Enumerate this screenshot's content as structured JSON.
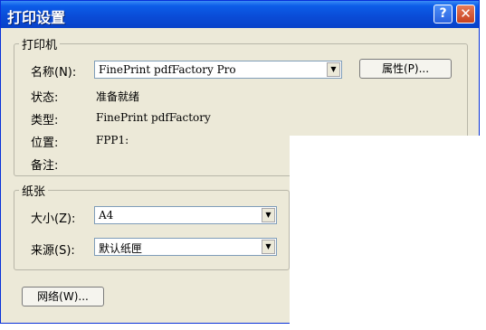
{
  "window": {
    "title": "打印设置",
    "help_icon": "?",
    "close_icon": "✕"
  },
  "printer_group": {
    "legend": "打印机",
    "name_label": "名称(N):",
    "name_value": "FinePrint pdfFactory Pro",
    "properties_button": "属性(P)...",
    "status_label": "状态:",
    "status_value": "准备就绪",
    "type_label": "类型:",
    "type_value": "FinePrint pdfFactory",
    "location_label": "位置:",
    "location_value": "FPP1:",
    "comment_label": "备注:"
  },
  "paper_group": {
    "legend": "纸张",
    "size_label": "大小(Z):",
    "size_value": "A4",
    "source_label": "来源(S):",
    "source_value": "默认纸匣"
  },
  "network_button": "网络(W)...",
  "dropdown_arrow": "▼"
}
